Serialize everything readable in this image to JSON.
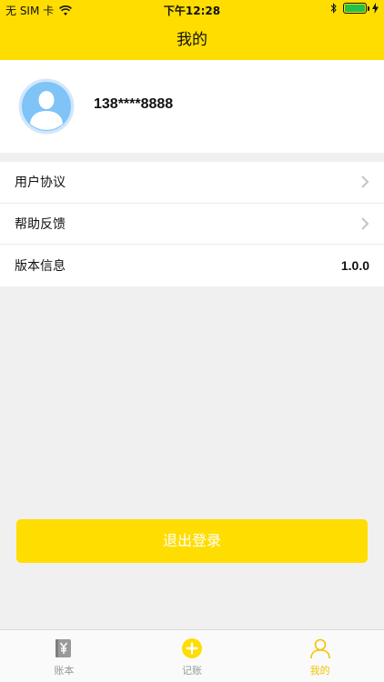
{
  "status_bar": {
    "carrier": "无 SIM 卡",
    "time": "下午12:28"
  },
  "nav": {
    "title": "我的"
  },
  "profile": {
    "phone": "138****8888"
  },
  "menu": {
    "items": [
      {
        "label": "用户协议"
      },
      {
        "label": "帮助反馈"
      },
      {
        "label": "版本信息",
        "value": "1.0.0"
      }
    ]
  },
  "logout": {
    "label": "退出登录"
  },
  "tabbar": {
    "tabs": [
      {
        "label": "账本",
        "icon": "ledger-icon"
      },
      {
        "label": "记账",
        "icon": "add-icon"
      },
      {
        "label": "我的",
        "icon": "profile-icon",
        "active": true
      }
    ]
  },
  "colors": {
    "accent": "#ffdd00",
    "active_tab": "#f2c400",
    "battery": "#22c24a"
  }
}
